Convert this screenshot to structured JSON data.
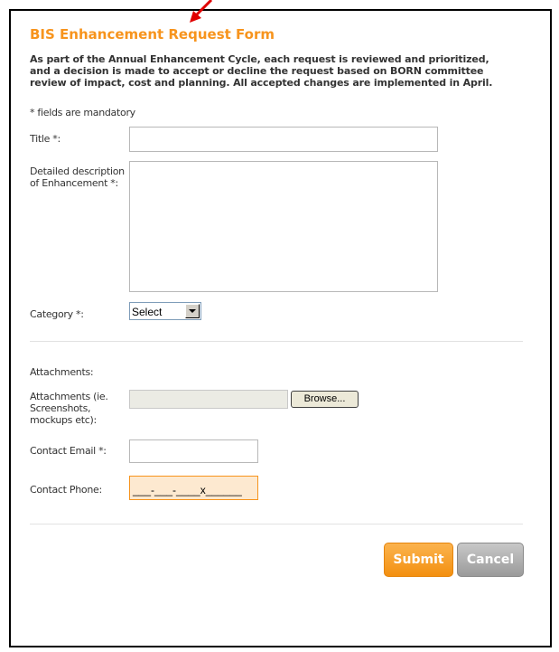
{
  "form": {
    "title": "BIS Enhancement Request Form",
    "intro_lines": [
      "As part of the Annual Enhancement Cycle, each request is reviewed and prioritized,",
      "and a decision is made to accept or decline the request based on BORN committee",
      "review of impact, cost and planning. All accepted changes are implemented in April."
    ],
    "mandatory_note": "* fields are mandatory"
  },
  "fields": {
    "title_label": "Title *:",
    "title_value": "",
    "description_label_lines": [
      "Detailed description",
      "of Enhancement *:"
    ],
    "description_value": "",
    "category_label": "Category *:",
    "category_value": "Select",
    "attachments_heading": "Attachments:",
    "attachments_label_lines": [
      "Attachments (ie.",
      "Screenshots,",
      "mockups etc):"
    ],
    "attachments_value": "",
    "browse_label": "Browse...",
    "email_label": "Contact Email *:",
    "email_value": "",
    "phone_label": "Contact Phone:",
    "phone_value": "___-___-____x______"
  },
  "actions": {
    "submit_label": "Submit",
    "cancel_label": "Cancel"
  },
  "colors": {
    "accent": "#f7941d",
    "annotation_arrow": "#e00000"
  }
}
